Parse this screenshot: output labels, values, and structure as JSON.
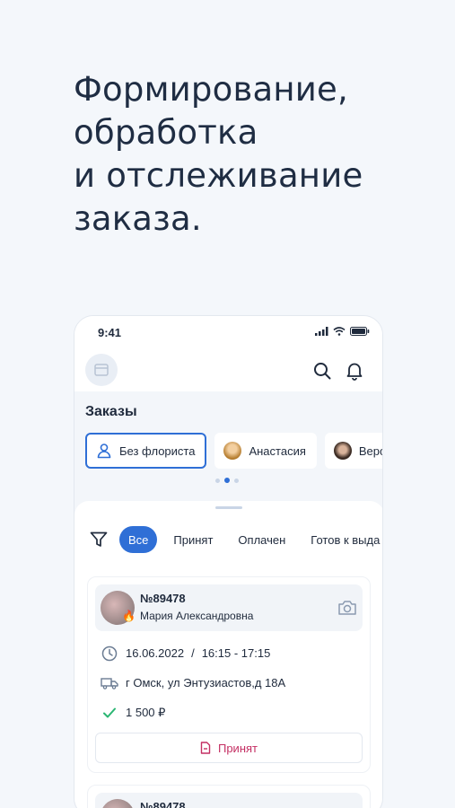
{
  "headline": {
    "lines": [
      "Формирование,",
      "обработка",
      "и отслеживание",
      "заказа."
    ]
  },
  "status_bar": {
    "time": "9:41"
  },
  "orders_section": {
    "title": "Заказы",
    "florists": [
      {
        "label": "Без флориста",
        "icon": "person-icon",
        "active": true
      },
      {
        "label": "Анастасия",
        "icon": "avatar",
        "active": false
      },
      {
        "label": "Верон",
        "icon": "avatar",
        "active": false
      }
    ],
    "page_dots": 3,
    "active_dot": 1
  },
  "filters": {
    "statuses": [
      "Все",
      "Принят",
      "Оплачен",
      "Готов к выда"
    ],
    "active": "Все"
  },
  "orders": [
    {
      "number": "№89478",
      "customer": "Мария Александровна",
      "date": "16.06.2022",
      "separator": "/",
      "time": "16:15 - 17:15",
      "address": "г Омск, ул Энтузиастов,д 18А",
      "price": "1 500 ₽",
      "status": "Принят"
    },
    {
      "number": "№89478"
    }
  ],
  "colors": {
    "accent": "#2f6fd6",
    "status_pink": "#c42f63",
    "check_green": "#2bb673",
    "background": "#f4f7fb"
  }
}
